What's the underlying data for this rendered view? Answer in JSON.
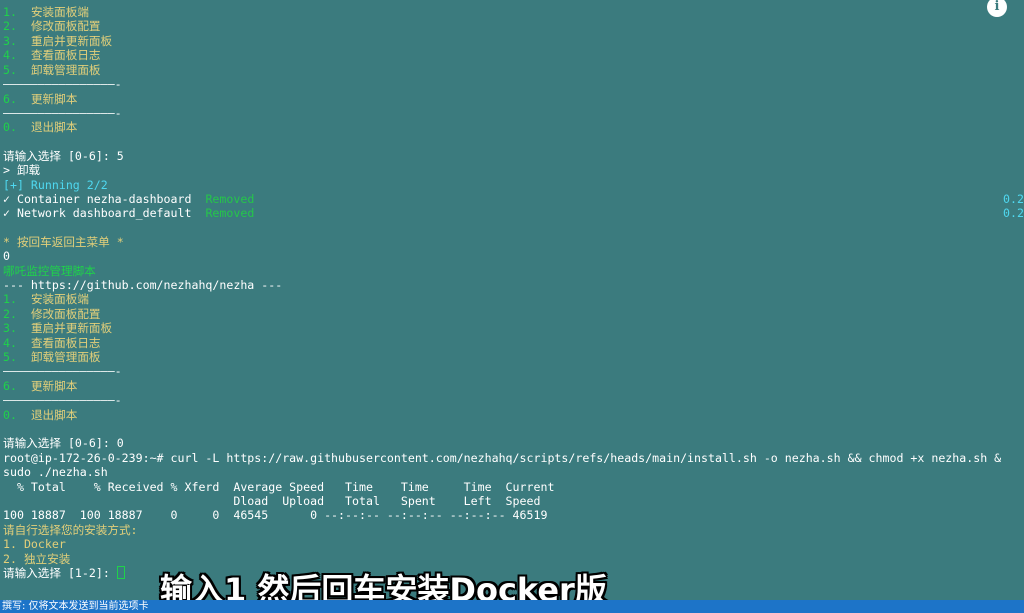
{
  "menu_top": {
    "items": [
      {
        "num": "1.",
        "label": "安装面板端"
      },
      {
        "num": "2.",
        "label": "修改面板配置"
      },
      {
        "num": "3.",
        "label": "重启并更新面板"
      },
      {
        "num": "4.",
        "label": "查看面板日志"
      },
      {
        "num": "5.",
        "label": "卸载管理面板"
      }
    ],
    "separator": "————————————————-",
    "update": {
      "num": "6.",
      "label": "更新脚本"
    },
    "exit": {
      "num": "0.",
      "label": "退出脚本"
    }
  },
  "uninstall": {
    "prompt": "请输入选择 [0-6]: 5",
    "action": "> 卸载",
    "running": "[+] Running 2/2",
    "rows": [
      {
        "name": "✓ Container nezha-dashboard",
        "status": "Removed",
        "time": "0.2"
      },
      {
        "name": "✓ Network dashboard_default",
        "status": "Removed",
        "time": "0.2"
      }
    ],
    "back_hint": "* 按回车返回主菜单 *",
    "input_zero": "0"
  },
  "menu_bottom": {
    "title": "哪吒监控管理脚本",
    "url_line": "--- https://github.com/nezhahq/nezha ---",
    "items": [
      {
        "num": "1.",
        "label": "安装面板端"
      },
      {
        "num": "2.",
        "label": "修改面板配置"
      },
      {
        "num": "3.",
        "label": "重启并更新面板"
      },
      {
        "num": "4.",
        "label": "查看面板日志"
      },
      {
        "num": "5.",
        "label": "卸载管理面板"
      }
    ],
    "separator": "————————————————-",
    "update": {
      "num": "6.",
      "label": "更新脚本"
    },
    "exit": {
      "num": "0.",
      "label": "退出脚本"
    },
    "prompt": "请输入选择 [0-6]: 0"
  },
  "command": {
    "line1": "root@ip-172-26-0-239:~# curl -L https://raw.githubusercontent.com/nezhahq/scripts/refs/heads/main/install.sh -o nezha.sh && chmod +x nezha.sh &",
    "line2": "sudo ./nezha.sh"
  },
  "curl_progress": {
    "header1": "  % Total    % Received % Xferd  Average Speed   Time    Time     Time  Current",
    "header2": "                                 Dload  Upload   Total   Spent    Left  Speed",
    "row": "100 18887  100 18887    0     0  46545      0 --:--:-- --:--:-- --:--:-- 46519"
  },
  "install_choice": {
    "question": "请自行选择您的安装方式:",
    "options": [
      "1. Docker",
      "2. 独立安装"
    ],
    "prompt": "请输入选择 [1-2]: "
  },
  "caption": "输入1 然后回车安装Docker版",
  "status_bar": "撰写: 仅将文本发送到当前选项卡",
  "icons": {
    "info": "info-icon"
  },
  "colors": {
    "background": "#3b7b7e",
    "green": "#1fd24a",
    "yellow": "#e2cf7a",
    "cyan": "#4fd8f0",
    "status_bar": "#1d74c8"
  }
}
